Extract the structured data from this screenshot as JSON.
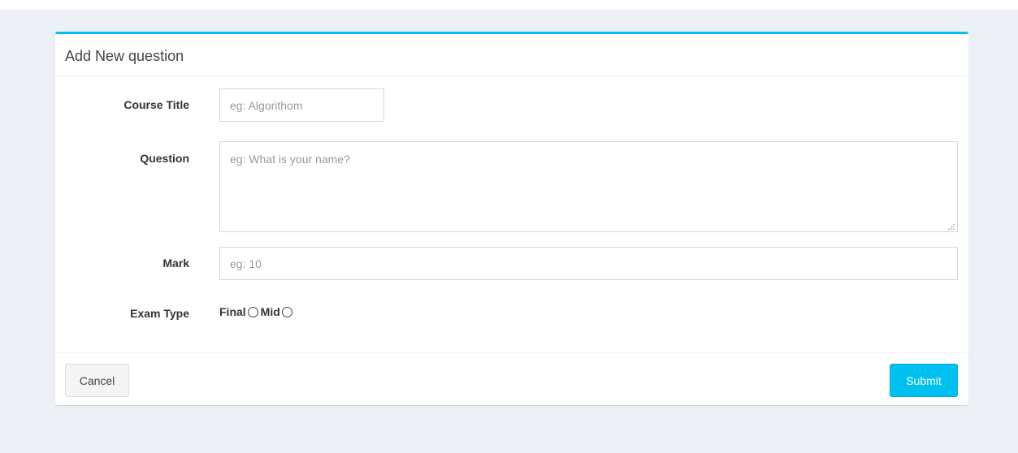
{
  "box": {
    "title": "Add New question",
    "accent_color": "#00c0ef"
  },
  "form": {
    "course_title": {
      "label": "Course Title",
      "placeholder": "eg: Algorithom",
      "value": ""
    },
    "question": {
      "label": "Question",
      "placeholder": "eg: What is your name?",
      "value": ""
    },
    "mark": {
      "label": "Mark",
      "placeholder": "eg: 10",
      "value": ""
    },
    "exam_type": {
      "label": "Exam Type",
      "options": [
        {
          "label": "Final",
          "selected": false
        },
        {
          "label": "Mid",
          "selected": false
        }
      ]
    }
  },
  "footer": {
    "cancel_label": "Cancel",
    "submit_label": "Submit",
    "submit_color": "#00c0ef"
  }
}
